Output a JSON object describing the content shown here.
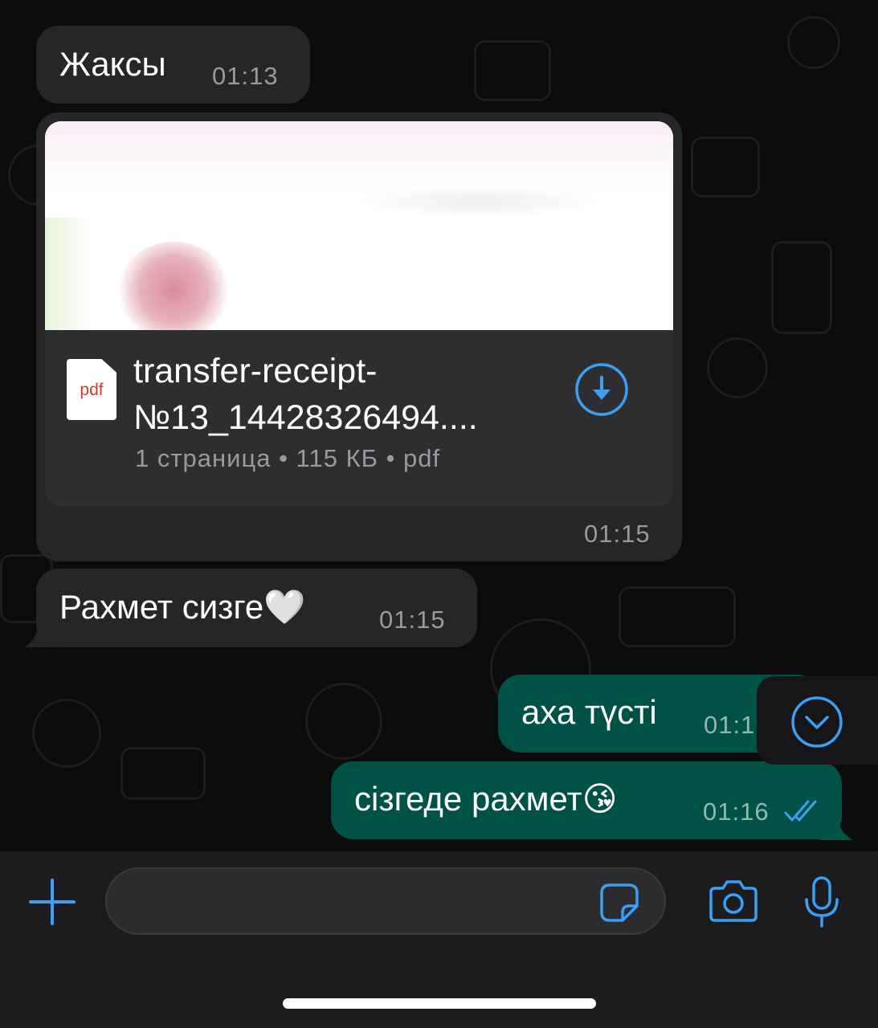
{
  "messages": [
    {
      "direction": "incoming",
      "text": "Жаксы",
      "time": "01:13"
    },
    {
      "direction": "incoming",
      "type": "document",
      "file_name": "transfer-receipt-№13_14428326494....",
      "file_type_badge": "pdf",
      "meta": "1 страница • 115 КБ • pdf",
      "time": "01:15"
    },
    {
      "direction": "incoming",
      "text": "Рахмет сизге🤍",
      "time": "01:15"
    },
    {
      "direction": "outgoing",
      "text": "аха түсті",
      "time": "01:1"
    },
    {
      "direction": "outgoing",
      "text": "сізгеде рахмет😘",
      "time": "01:16",
      "status": "read"
    }
  ],
  "icons": {
    "download": "download-arrow-icon",
    "scroll_down": "chevron-down-icon",
    "read_status": "double-check-icon",
    "attach": "plus-icon",
    "sticker": "sticker-icon",
    "camera": "camera-icon",
    "microphone": "microphone-icon"
  },
  "colors": {
    "accent": "#3a9ff5",
    "incoming_bubble": "#262628",
    "outgoing_bubble": "#005246",
    "background": "#0c0c0c"
  },
  "input": {
    "placeholder": ""
  }
}
